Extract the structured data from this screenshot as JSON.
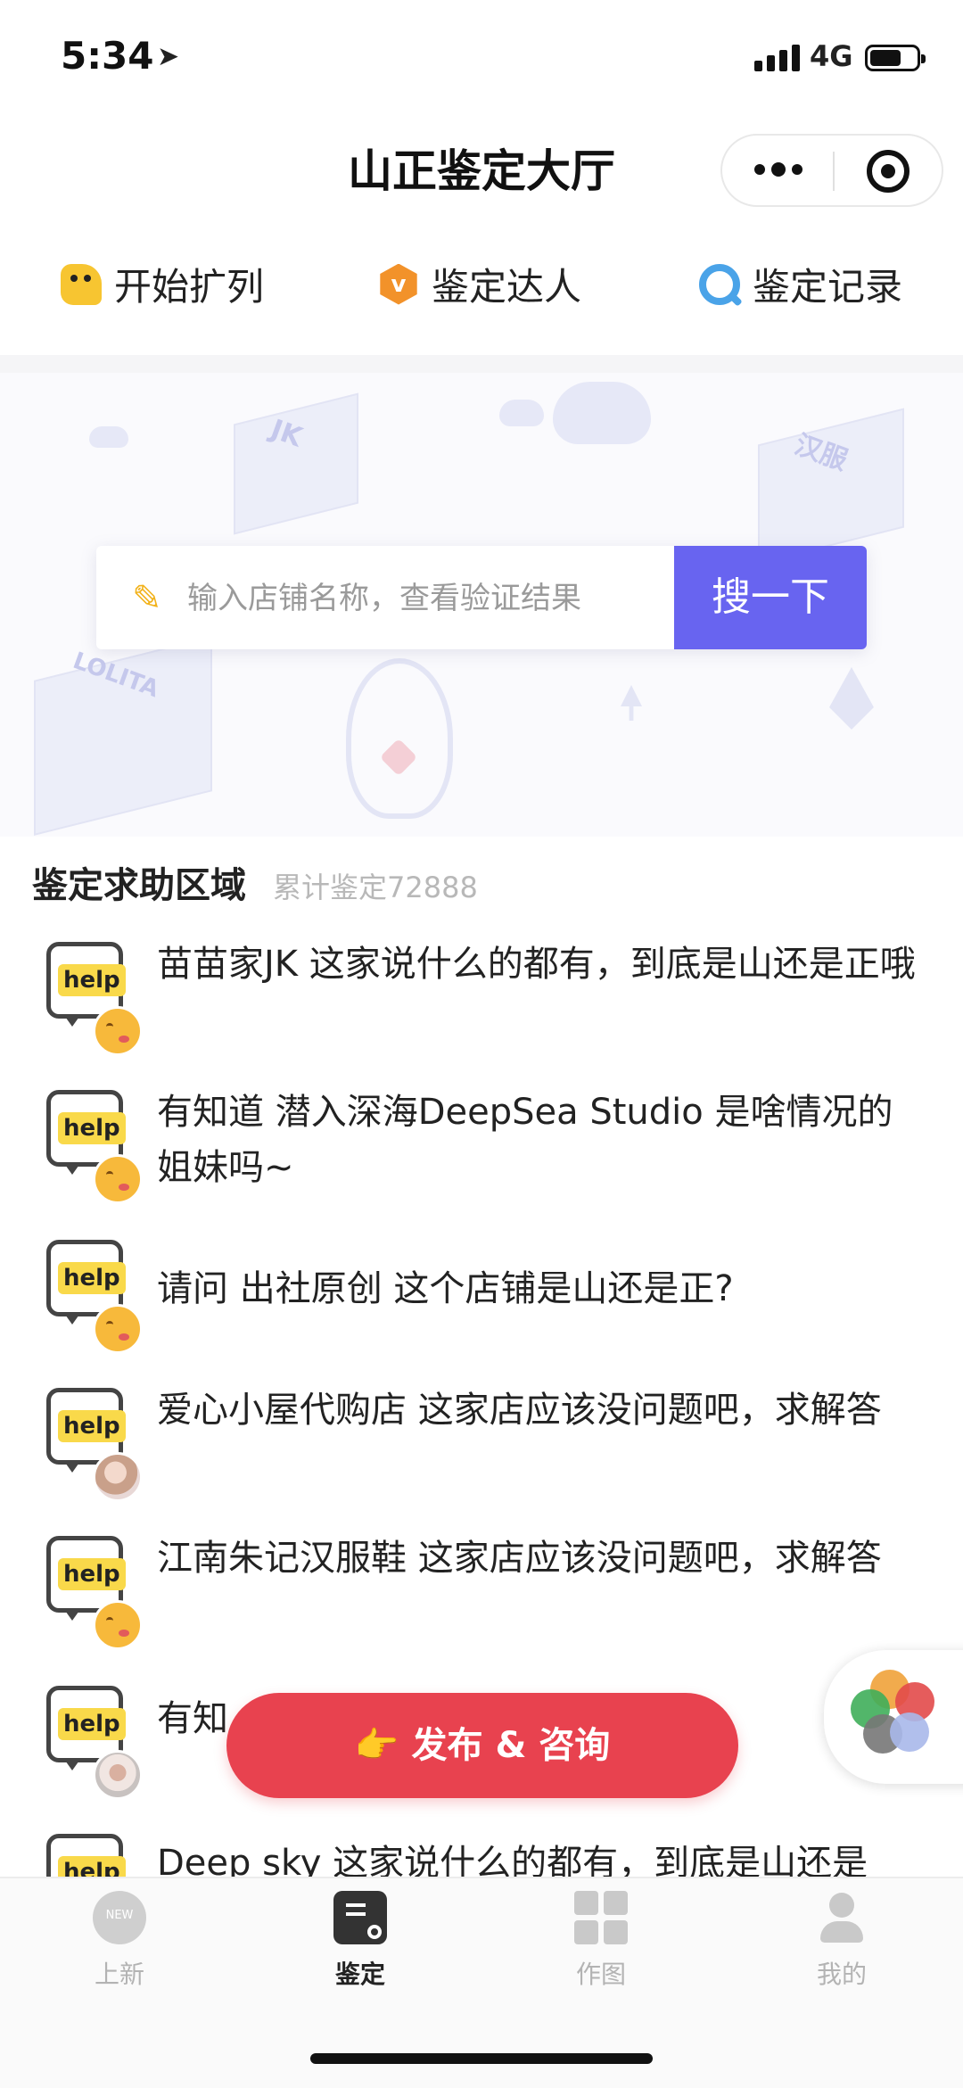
{
  "status": {
    "time": "5:34",
    "network": "4G"
  },
  "nav": {
    "title": "山正鉴定大厅"
  },
  "quick_menu": [
    {
      "label": "开始扩列",
      "icon": "bird-icon"
    },
    {
      "label": "鉴定达人",
      "icon": "v-badge-icon"
    },
    {
      "label": "鉴定记录",
      "icon": "search-ring-icon"
    }
  ],
  "banner": {
    "cube_labels": [
      "JK",
      "汉服",
      "LOLITA"
    ],
    "search_placeholder": "输入店铺名称，查看验证结果",
    "search_button": "搜一下"
  },
  "section": {
    "title": "鉴定求助区域",
    "count": "累计鉴定72888"
  },
  "help_tag": "help",
  "posts": [
    {
      "text": "苗苗家JK 这家说什么的都有，到底是山还是正哦"
    },
    {
      "text": "有知道 潜入深海DeepSea Studio 是啥情况的姐妹吗~"
    },
    {
      "text": "请问 出社原创 这个店铺是山还是正?"
    },
    {
      "text": "爱心小屋代购店 这家店应该没问题吧，求解答"
    },
    {
      "text": "江南朱记汉服鞋 这家店应该没问题吧，求解答"
    },
    {
      "text": "有知"
    },
    {
      "text": "Deep sky 这家说什么的都有，到底是山还是"
    }
  ],
  "fab": {
    "icon": "👉",
    "label": "发布 & 咨询"
  },
  "tabs": [
    {
      "label": "上新",
      "badge": "NEW"
    },
    {
      "label": "鉴定"
    },
    {
      "label": "作图"
    },
    {
      "label": "我的"
    }
  ],
  "colors": {
    "accent": "#6864f0",
    "fab": "#e8424f",
    "help_tag": "#f9d94a"
  }
}
